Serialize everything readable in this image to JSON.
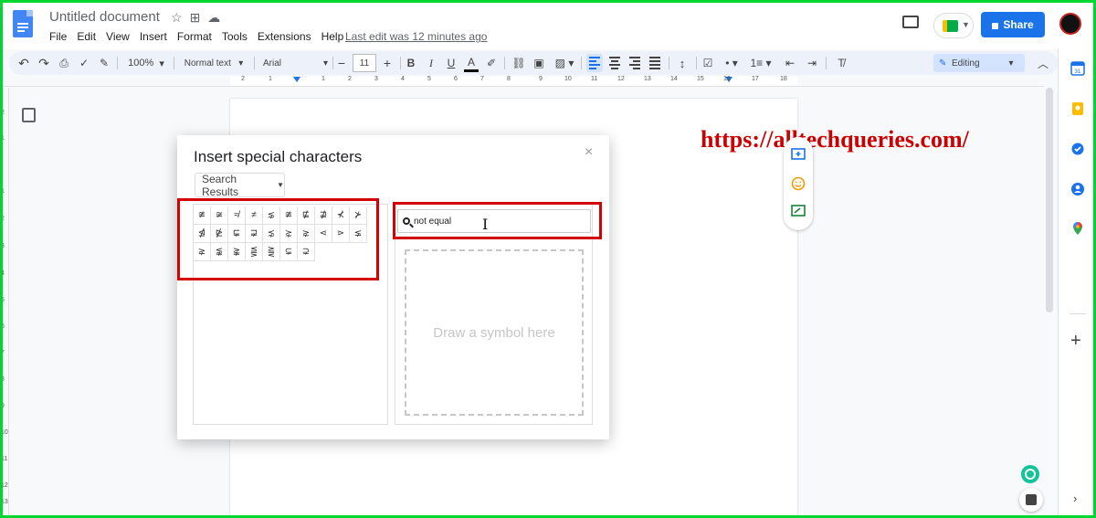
{
  "doc": {
    "title": "Untitled document",
    "last_edit": "Last edit was 12 minutes ago"
  },
  "menu": [
    "File",
    "Edit",
    "View",
    "Insert",
    "Format",
    "Tools",
    "Extensions",
    "Help"
  ],
  "header": {
    "share_label": "Share"
  },
  "toolbar": {
    "zoom": "100%",
    "style": "Normal text",
    "font": "Arial",
    "font_size": "11",
    "bold": "B",
    "italic": "I",
    "underline": "U",
    "text_color": "A",
    "mode": "Editing"
  },
  "ruler": {
    "h_ticks": [
      "2",
      "1",
      "1",
      "2",
      "3",
      "4",
      "5",
      "6",
      "7",
      "8",
      "9",
      "10",
      "11",
      "12",
      "13",
      "14",
      "15",
      "16",
      "17",
      "18"
    ],
    "v_ticks": [
      "2",
      "1",
      "1",
      "2",
      "3",
      "4",
      "5",
      "6",
      "7",
      "8",
      "9",
      "10",
      "11",
      "12",
      "13",
      "14",
      "15"
    ]
  },
  "watermark": "https://alltechqueries.com/",
  "dialog": {
    "title": "Insert special characters",
    "close": "×",
    "category": "Search Results",
    "search_value": "not equal",
    "draw_placeholder": "Draw a symbol here",
    "characters": [
      "≇",
      "≆",
      "≉",
      "≠",
      "⋦",
      "≇",
      "⋢",
      "⋣",
      "⊀",
      "⊁",
      "⋬",
      "⋭",
      "⋤",
      "⋥",
      "⋨",
      "⋩",
      "⋧",
      "⋖",
      "⋗",
      "⪇",
      "⪈",
      "⪉",
      "⪊",
      "⪋",
      "⪌",
      "⊊",
      "⊋"
    ]
  },
  "colors": {
    "frame": "#00d632",
    "share": "#1a73e8",
    "highlight": "#d50000",
    "watermark": "#cc0000"
  },
  "icons": {
    "side_panel": [
      "calendar-icon",
      "keep-icon",
      "tasks-icon",
      "contacts-icon",
      "maps-icon",
      "add-icon"
    ],
    "float_actions": [
      "add-comment-icon",
      "emoji-icon",
      "suggest-edit-icon"
    ]
  }
}
